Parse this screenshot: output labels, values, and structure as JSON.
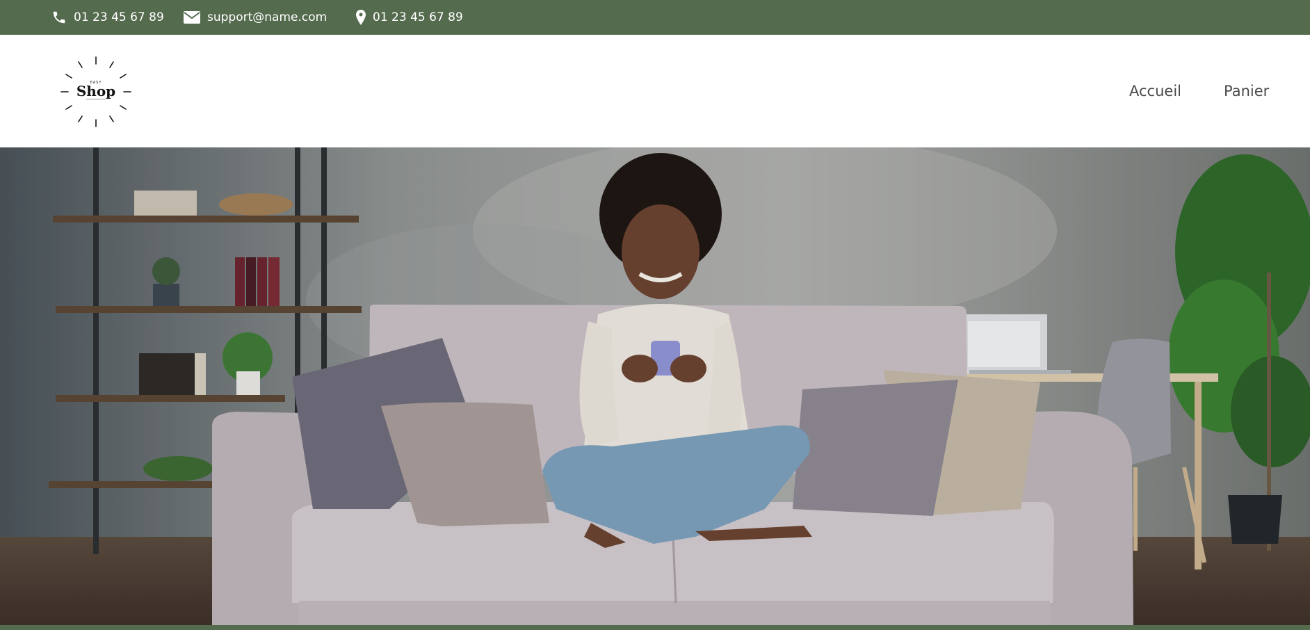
{
  "topbar": {
    "phone": "01 23 45 67 89",
    "email": "support@name.com",
    "address": "01 23 45 67 89",
    "phone_icon": "phone-icon",
    "email_icon": "envelope-icon",
    "address_icon": "map-pin-icon",
    "background": "#556b4e"
  },
  "logo": {
    "top_text": "EASY",
    "name": "Shop"
  },
  "nav": {
    "items": [
      {
        "label": "Accueil"
      },
      {
        "label": "Panier"
      }
    ]
  },
  "hero": {
    "image": "woman-on-sofa-photo"
  }
}
